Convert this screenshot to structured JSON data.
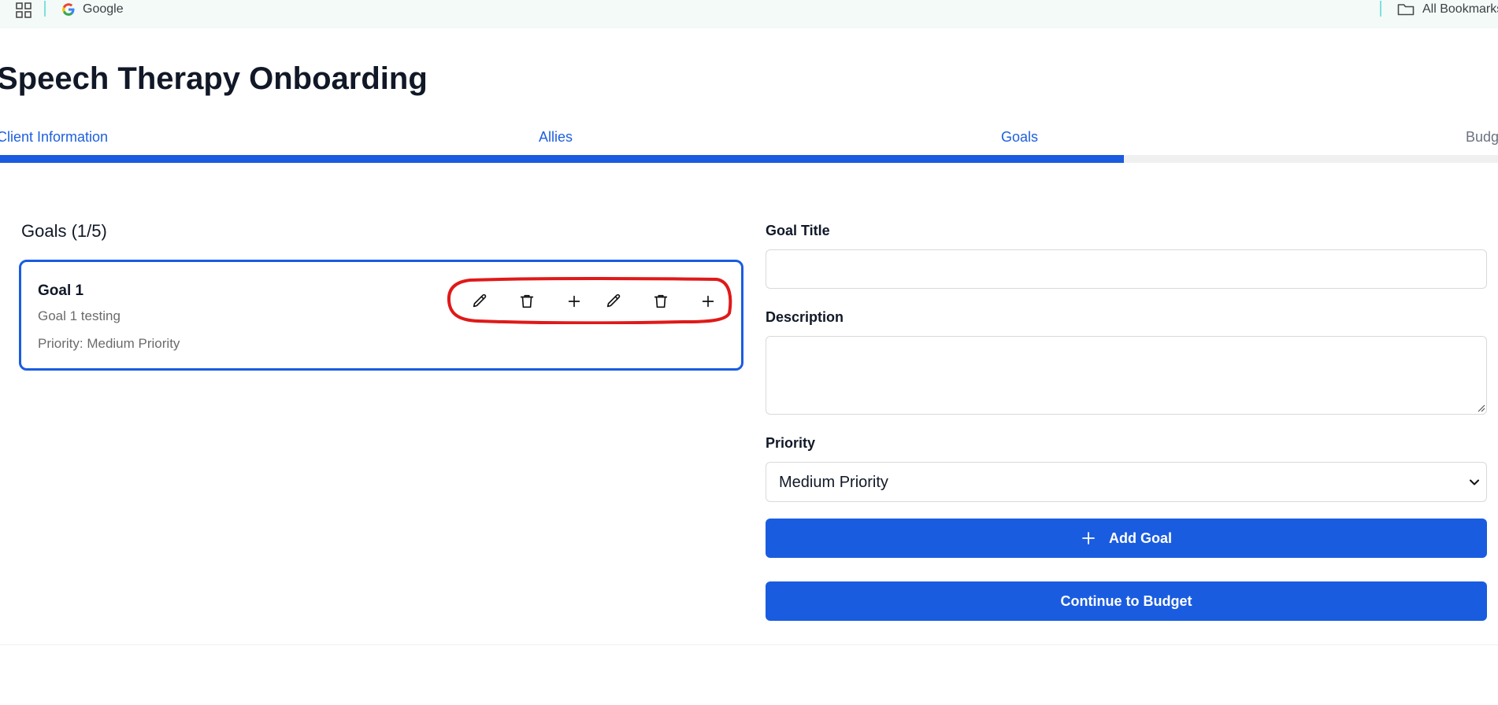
{
  "bookmarks_bar": {
    "google_label": "Google",
    "all_bookmarks_label": "All Bookmarks"
  },
  "page": {
    "title": "Speech Therapy Onboarding"
  },
  "steps": {
    "tabs": [
      {
        "label": "Client Information"
      },
      {
        "label": "Allies"
      },
      {
        "label": "Goals"
      },
      {
        "label": "Budg"
      }
    ],
    "progress_fraction": 0.75
  },
  "goals_list": {
    "heading": "Goals (1/5)",
    "items": [
      {
        "title": "Goal 1",
        "description": "Goal 1 testing",
        "priority": "Priority: Medium Priority",
        "actions": [
          "pencil-icon",
          "trash-icon",
          "plus-icon",
          "pencil-icon",
          "trash-icon",
          "plus-icon"
        ]
      }
    ]
  },
  "form": {
    "goal_title_label": "Goal Title",
    "goal_title_value": "",
    "description_label": "Description",
    "description_value": "",
    "priority_label": "Priority",
    "priority_value": "Medium Priority",
    "add_goal_label": "Add Goal",
    "continue_label": "Continue to Budget"
  },
  "colors": {
    "accent": "#1a5ce0",
    "annotation": "#e01919"
  }
}
